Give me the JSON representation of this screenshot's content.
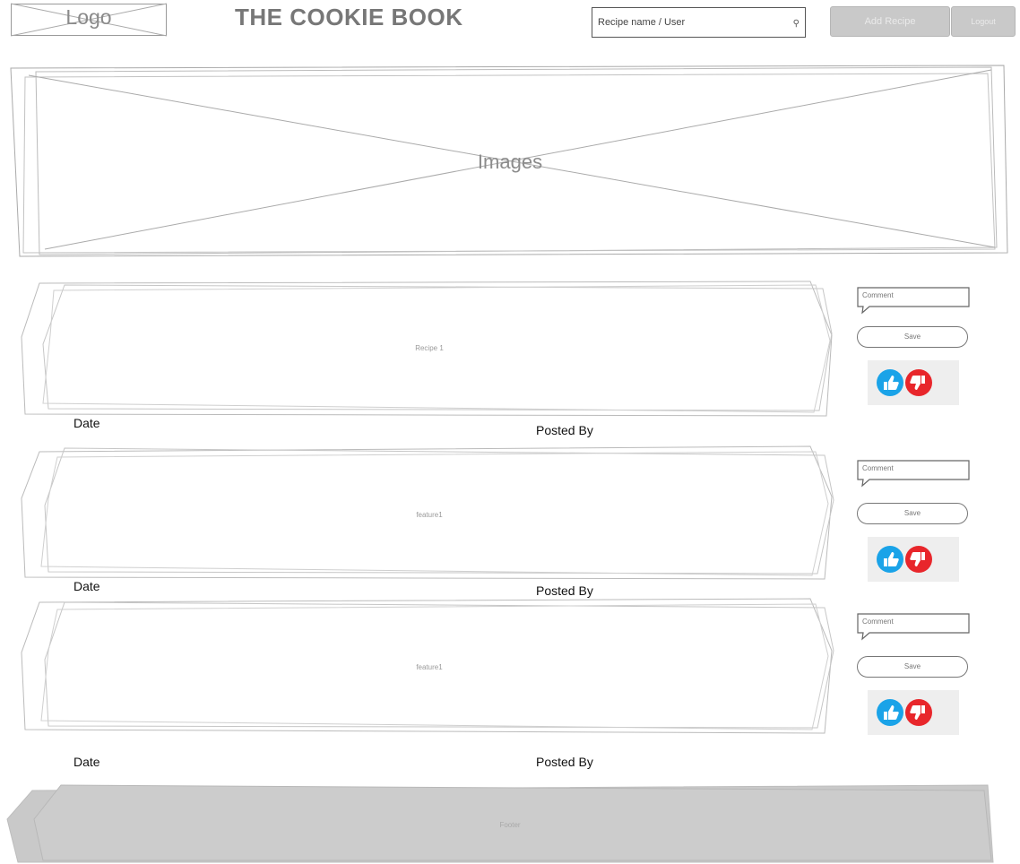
{
  "header": {
    "logo_label": "Logo",
    "title": "THE COOKIE BOOK",
    "search": {
      "placeholder": "Recipe name / User",
      "icon": "search-icon"
    },
    "add_recipe_label": "Add Recipe",
    "logout_label": "Logout"
  },
  "hero": {
    "label": "Images"
  },
  "recipes": [
    {
      "label": "Recipe 1",
      "date_label": "Date",
      "posted_by_label": "Posted By",
      "comment_label": "Comment",
      "save_label": "Save"
    },
    {
      "label": "feature1",
      "date_label": "Date",
      "posted_by_label": "Posted By",
      "comment_label": "Comment",
      "save_label": "Save"
    },
    {
      "label": "feature1",
      "date_label": "Date",
      "posted_by_label": "Posted By",
      "comment_label": "Comment",
      "save_label": "Save"
    }
  ],
  "footer": {
    "label": "Footer"
  },
  "colors": {
    "like": "#1aa3e8",
    "dislike": "#e8262b",
    "footer_bg": "#c9c9c9"
  }
}
